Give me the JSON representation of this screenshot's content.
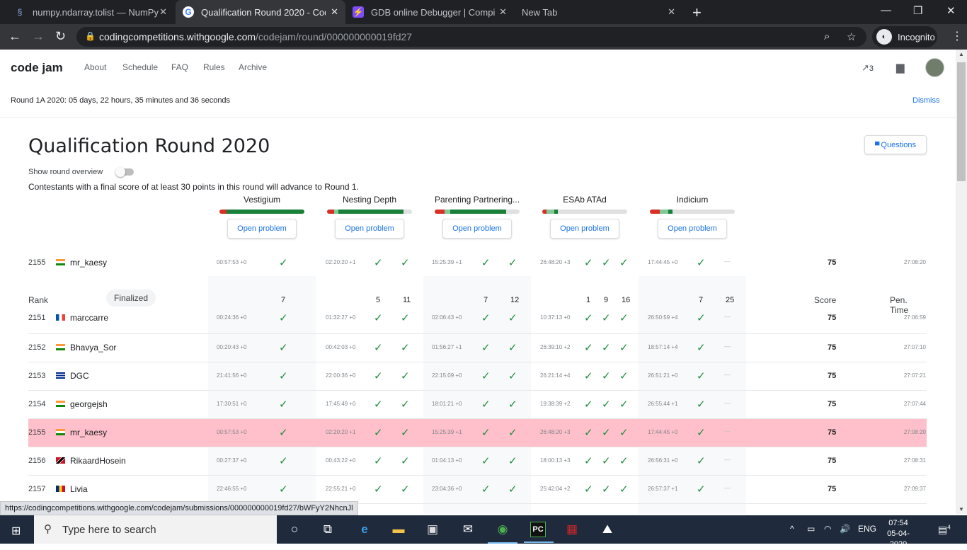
{
  "browser": {
    "tabs": [
      {
        "title": "numpy.ndarray.tolist — NumPy v",
        "icon": "numpy-icon"
      },
      {
        "title": "Qualification Round 2020 - Code",
        "icon": "google-icon",
        "active": true
      },
      {
        "title": "GDB online Debugger | Compiler",
        "icon": "gdb-icon"
      },
      {
        "title": "New Tab",
        "icon": ""
      }
    ],
    "url_host": "codingcompetitions.withgoogle.com",
    "url_path": "/codejam/round/000000000019fd27",
    "incognito_label": "Incognito"
  },
  "site": {
    "logo": "code jam",
    "nav": [
      "About",
      "Schedule",
      "FAQ",
      "Rules",
      "Archive"
    ],
    "notifications_count": "3"
  },
  "banner": {
    "countdown": "Round 1A 2020:  05 days, 22 hours, 35 minutes and 36 seconds",
    "dismiss": "Dismiss"
  },
  "round": {
    "title": "Qualification Round 2020",
    "questions_button": "Questions",
    "toggle_label": "Show round overview",
    "advance_text": "Contestants with a final score of at least 30 points in this round will advance to Round 1."
  },
  "problems": [
    {
      "name": "Vestigium",
      "button": "Open problem",
      "bar": {
        "red": 0.08,
        "lightgreen": 0,
        "green": 0.92
      }
    },
    {
      "name": "Nesting Depth",
      "button": "Open problem",
      "bar": {
        "red": 0.08,
        "lightgreen": 0.05,
        "green": 0.77
      }
    },
    {
      "name": "Parenting Partnering...",
      "button": "Open problem",
      "bar": {
        "red": 0.12,
        "lightgreen": 0.06,
        "green": 0.66
      }
    },
    {
      "name": "ESAb ATAd",
      "button": "Open problem",
      "bar": {
        "red": 0.05,
        "lightgreen": 0.09,
        "green": 0.04
      }
    },
    {
      "name": "Indicium",
      "button": "Open problem",
      "bar": {
        "red": 0.12,
        "lightgreen": 0.1,
        "green": 0.05
      }
    }
  ],
  "table": {
    "headers": {
      "rank": "Rank",
      "finalized": "Finalized",
      "score": "Score",
      "pen_time": "Pen. Time"
    },
    "points": [
      [
        "7"
      ],
      [
        "5",
        "11"
      ],
      [
        "7",
        "12"
      ],
      [
        "1",
        "9",
        "16"
      ],
      [
        "7",
        "25"
      ]
    ],
    "pinned_row": {
      "rank": "2155",
      "flag": "india",
      "name": "mr_kaesy",
      "times": [
        "00:57:53 +0",
        "02:20:20 +1",
        "15:25:39 +1",
        "26:48:20 +3",
        "17:44:45 +0"
      ],
      "score": "75",
      "pen": "27:08:20"
    },
    "rows": [
      {
        "rank": "2151",
        "flag": "france",
        "name": "marccarre",
        "times": [
          "00:24:36 +0",
          "01:32:27 +0",
          "02:06:43 +0",
          "10:37:13 +0",
          "26:50:59 +4"
        ],
        "score": "75",
        "pen": "27:06:59"
      },
      {
        "rank": "2152",
        "flag": "india",
        "name": "Bhavya_Sor",
        "times": [
          "00:20:43 +0",
          "00:42:03 +0",
          "01:56:27 +1",
          "26:39:10 +2",
          "18:57:14 +4"
        ],
        "score": "75",
        "pen": "27:07:10"
      },
      {
        "rank": "2153",
        "flag": "cuba",
        "name": "DGC",
        "times": [
          "21:41:56 +0",
          "22:00:36 +0",
          "22:15:09 +0",
          "26:21:14 +4",
          "26:51:21 +0"
        ],
        "score": "75",
        "pen": "27:07:21"
      },
      {
        "rank": "2154",
        "flag": "india",
        "name": "georgejsh",
        "times": [
          "17:30:51 +0",
          "17:45:49 +0",
          "18:01:21 +0",
          "19:38:39 +2",
          "26:55:44 +1"
        ],
        "score": "75",
        "pen": "27:07:44"
      },
      {
        "rank": "2155",
        "flag": "india",
        "name": "mr_kaesy",
        "times": [
          "00:57:53 +0",
          "02:20:20 +1",
          "15:25:39 +1",
          "26:48:20 +3",
          "17:44:45 +0"
        ],
        "score": "75",
        "pen": "27:08:20",
        "highlight": true
      },
      {
        "rank": "2156",
        "flag": "trinidad",
        "name": "RikaardHosein",
        "times": [
          "00:27:37 +0",
          "00:43:22 +0",
          "01:04:13 +0",
          "18:00:13 +3",
          "26:56:31 +0"
        ],
        "score": "75",
        "pen": "27:08:31"
      },
      {
        "rank": "2157",
        "flag": "romania",
        "name": "Livia",
        "times": [
          "22:46:55 +0",
          "22:55:21 +0",
          "23:04:36 +0",
          "25:42:04 +2",
          "26:57:37 +1"
        ],
        "score": "75",
        "pen": "27:09:37"
      }
    ]
  },
  "status_url": "https://codingcompetitions.withgoogle.com/codejam/submissions/000000000019fd27/bWFyY2NhcnJl",
  "taskbar": {
    "search_placeholder": "Type here to search",
    "lang": "ENG",
    "time": "07:54",
    "date": "05-04-2020",
    "notif_count": "4"
  },
  "colors": {
    "check": "#1e8e3e",
    "highlight": "#ffc0cb",
    "link": "#1a73e8",
    "bar_red": "#d93025",
    "bar_green": "#188038",
    "bar_lightgreen": "#81c995"
  }
}
